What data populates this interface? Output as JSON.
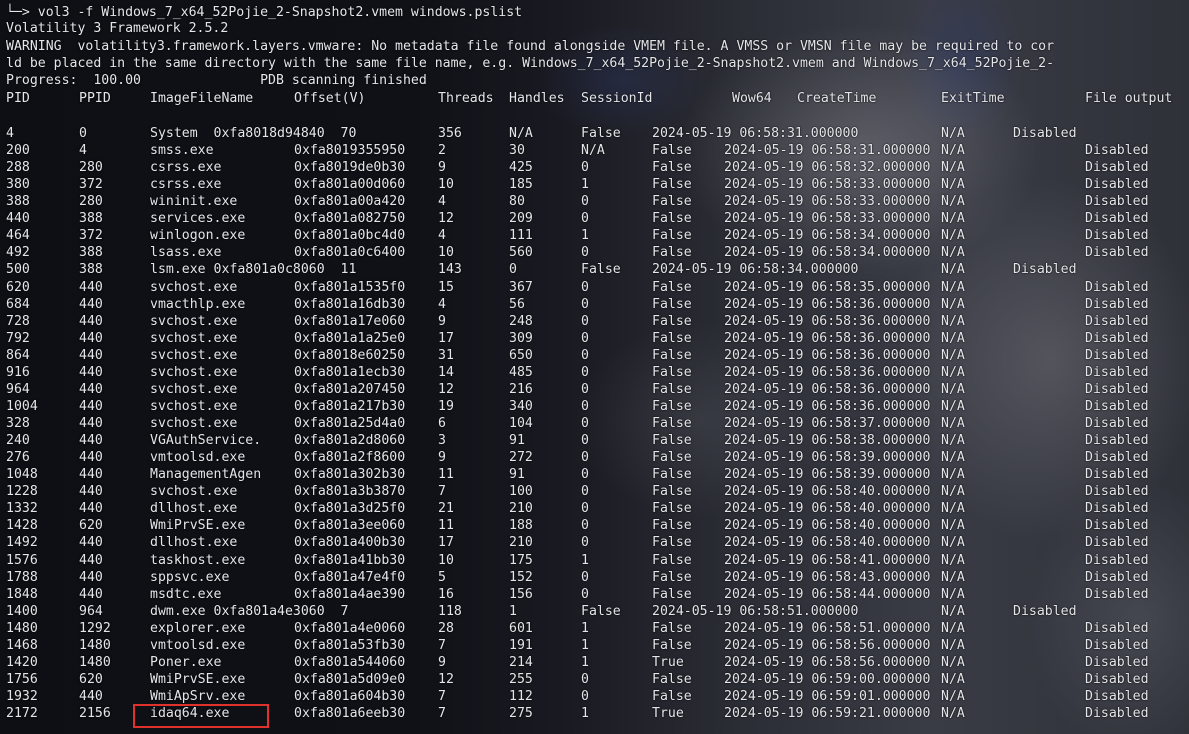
{
  "command": {
    "prompt_symbol": "└─>",
    "text": " vol3 -f Windows_7_x64_52Pojie_2-Snapshot2.vmem windows.pslist"
  },
  "output": {
    "banner": "Volatility 3 Framework 2.5.2",
    "warning_line1": "WARNING  volatility3.framework.layers.vmware: No metadata file found alongside VMEM file. A VMSS or VMSN file may be required to cor",
    "warning_line2": "ld be placed in the same directory with the same file name, e.g. Windows_7_x64_52Pojie_2-Snapshot2.vmem and Windows_7_x64_52Pojie_2-",
    "progress": "Progress:  100.00               PDB scanning finished"
  },
  "table": {
    "headers": [
      "PID",
      "PPID",
      "ImageFileName",
      "Offset(V)",
      "Threads",
      "Handles",
      "SessionId",
      "Wow64",
      "CreateTime",
      "ExitTime",
      "File output"
    ],
    "rows": [
      {
        "malformed": true,
        "pid": "4",
        "ppid": "0",
        "name": "System  0xfa8018d94840  70",
        "threads": "356",
        "handles": "N/A",
        "wow": "False",
        "ct": "2024-05-19 06:58:31.000000",
        "et": "N/A",
        "fo": "Disabled"
      },
      {
        "pid": "200",
        "ppid": "4",
        "name": "smss.exe",
        "off": "0xfa8019355950",
        "threads": "2",
        "handles": "30",
        "sess": "N/A",
        "wow": "False",
        "ct": "2024-05-19 06:58:31.000000",
        "et": "N/A",
        "fo": "Disabled"
      },
      {
        "pid": "288",
        "ppid": "280",
        "name": "csrss.exe",
        "off": "0xfa8019de0b30",
        "threads": "9",
        "handles": "425",
        "sess": "0",
        "wow": "False",
        "ct": "2024-05-19 06:58:32.000000",
        "et": "N/A",
        "fo": "Disabled"
      },
      {
        "pid": "380",
        "ppid": "372",
        "name": "csrss.exe",
        "off": "0xfa801a00d060",
        "threads": "10",
        "handles": "185",
        "sess": "1",
        "wow": "False",
        "ct": "2024-05-19 06:58:33.000000",
        "et": "N/A",
        "fo": "Disabled"
      },
      {
        "pid": "388",
        "ppid": "280",
        "name": "wininit.exe",
        "off": "0xfa801a00a420",
        "threads": "4",
        "handles": "80",
        "sess": "0",
        "wow": "False",
        "ct": "2024-05-19 06:58:33.000000",
        "et": "N/A",
        "fo": "Disabled"
      },
      {
        "pid": "440",
        "ppid": "388",
        "name": "services.exe",
        "off": "0xfa801a082750",
        "threads": "12",
        "handles": "209",
        "sess": "0",
        "wow": "False",
        "ct": "2024-05-19 06:58:33.000000",
        "et": "N/A",
        "fo": "Disabled"
      },
      {
        "pid": "464",
        "ppid": "372",
        "name": "winlogon.exe",
        "off": "0xfa801a0bc4d0",
        "threads": "4",
        "handles": "111",
        "sess": "1",
        "wow": "False",
        "ct": "2024-05-19 06:58:34.000000",
        "et": "N/A",
        "fo": "Disabled"
      },
      {
        "pid": "492",
        "ppid": "388",
        "name": "lsass.exe",
        "off": "0xfa801a0c6400",
        "threads": "10",
        "handles": "560",
        "sess": "0",
        "wow": "False",
        "ct": "2024-05-19 06:58:34.000000",
        "et": "N/A",
        "fo": "Disabled"
      },
      {
        "malformed": true,
        "pid": "500",
        "ppid": "388",
        "name": "lsm.exe 0xfa801a0c8060  11",
        "threads": "143",
        "handles": "0",
        "wow": "False",
        "ct": "2024-05-19 06:58:34.000000",
        "et": "N/A",
        "fo": "Disabled"
      },
      {
        "pid": "620",
        "ppid": "440",
        "name": "svchost.exe",
        "off": "0xfa801a1535f0",
        "threads": "15",
        "handles": "367",
        "sess": "0",
        "wow": "False",
        "ct": "2024-05-19 06:58:35.000000",
        "et": "N/A",
        "fo": "Disabled"
      },
      {
        "pid": "684",
        "ppid": "440",
        "name": "vmacthlp.exe",
        "off": "0xfa801a16db30",
        "threads": "4",
        "handles": "56",
        "sess": "0",
        "wow": "False",
        "ct": "2024-05-19 06:58:36.000000",
        "et": "N/A",
        "fo": "Disabled"
      },
      {
        "pid": "728",
        "ppid": "440",
        "name": "svchost.exe",
        "off": "0xfa801a17e060",
        "threads": "9",
        "handles": "248",
        "sess": "0",
        "wow": "False",
        "ct": "2024-05-19 06:58:36.000000",
        "et": "N/A",
        "fo": "Disabled"
      },
      {
        "pid": "792",
        "ppid": "440",
        "name": "svchost.exe",
        "off": "0xfa801a1a25e0",
        "threads": "17",
        "handles": "309",
        "sess": "0",
        "wow": "False",
        "ct": "2024-05-19 06:58:36.000000",
        "et": "N/A",
        "fo": "Disabled"
      },
      {
        "pid": "864",
        "ppid": "440",
        "name": "svchost.exe",
        "off": "0xfa8018e60250",
        "threads": "31",
        "handles": "650",
        "sess": "0",
        "wow": "False",
        "ct": "2024-05-19 06:58:36.000000",
        "et": "N/A",
        "fo": "Disabled"
      },
      {
        "pid": "916",
        "ppid": "440",
        "name": "svchost.exe",
        "off": "0xfa801a1ecb30",
        "threads": "14",
        "handles": "485",
        "sess": "0",
        "wow": "False",
        "ct": "2024-05-19 06:58:36.000000",
        "et": "N/A",
        "fo": "Disabled"
      },
      {
        "pid": "964",
        "ppid": "440",
        "name": "svchost.exe",
        "off": "0xfa801a207450",
        "threads": "12",
        "handles": "216",
        "sess": "0",
        "wow": "False",
        "ct": "2024-05-19 06:58:36.000000",
        "et": "N/A",
        "fo": "Disabled"
      },
      {
        "pid": "1004",
        "ppid": "440",
        "name": "svchost.exe",
        "off": "0xfa801a217b30",
        "threads": "19",
        "handles": "340",
        "sess": "0",
        "wow": "False",
        "ct": "2024-05-19 06:58:36.000000",
        "et": "N/A",
        "fo": "Disabled"
      },
      {
        "pid": "328",
        "ppid": "440",
        "name": "svchost.exe",
        "off": "0xfa801a25d4a0",
        "threads": "6",
        "handles": "104",
        "sess": "0",
        "wow": "False",
        "ct": "2024-05-19 06:58:37.000000",
        "et": "N/A",
        "fo": "Disabled"
      },
      {
        "pid": "240",
        "ppid": "440",
        "name": "VGAuthService.",
        "off": "0xfa801a2d8060",
        "threads": "3",
        "handles": "91",
        "sess": "0",
        "wow": "False",
        "ct": "2024-05-19 06:58:38.000000",
        "et": "N/A",
        "fo": "Disabled"
      },
      {
        "pid": "276",
        "ppid": "440",
        "name": "vmtoolsd.exe",
        "off": "0xfa801a2f8600",
        "threads": "9",
        "handles": "272",
        "sess": "0",
        "wow": "False",
        "ct": "2024-05-19 06:58:39.000000",
        "et": "N/A",
        "fo": "Disabled"
      },
      {
        "pid": "1048",
        "ppid": "440",
        "name": "ManagementAgen",
        "off": "0xfa801a302b30",
        "threads": "11",
        "handles": "91",
        "sess": "0",
        "wow": "False",
        "ct": "2024-05-19 06:58:39.000000",
        "et": "N/A",
        "fo": "Disabled"
      },
      {
        "pid": "1228",
        "ppid": "440",
        "name": "svchost.exe",
        "off": "0xfa801a3b3870",
        "threads": "7",
        "handles": "100",
        "sess": "0",
        "wow": "False",
        "ct": "2024-05-19 06:58:40.000000",
        "et": "N/A",
        "fo": "Disabled"
      },
      {
        "pid": "1332",
        "ppid": "440",
        "name": "dllhost.exe",
        "off": "0xfa801a3d25f0",
        "threads": "21",
        "handles": "210",
        "sess": "0",
        "wow": "False",
        "ct": "2024-05-19 06:58:40.000000",
        "et": "N/A",
        "fo": "Disabled"
      },
      {
        "pid": "1428",
        "ppid": "620",
        "name": "WmiPrvSE.exe",
        "off": "0xfa801a3ee060",
        "threads": "11",
        "handles": "188",
        "sess": "0",
        "wow": "False",
        "ct": "2024-05-19 06:58:40.000000",
        "et": "N/A",
        "fo": "Disabled"
      },
      {
        "pid": "1492",
        "ppid": "440",
        "name": "dllhost.exe",
        "off": "0xfa801a400b30",
        "threads": "17",
        "handles": "210",
        "sess": "0",
        "wow": "False",
        "ct": "2024-05-19 06:58:40.000000",
        "et": "N/A",
        "fo": "Disabled"
      },
      {
        "pid": "1576",
        "ppid": "440",
        "name": "taskhost.exe",
        "off": "0xfa801a41bb30",
        "threads": "10",
        "handles": "175",
        "sess": "1",
        "wow": "False",
        "ct": "2024-05-19 06:58:41.000000",
        "et": "N/A",
        "fo": "Disabled"
      },
      {
        "pid": "1788",
        "ppid": "440",
        "name": "sppsvc.exe",
        "off": "0xfa801a47e4f0",
        "threads": "5",
        "handles": "152",
        "sess": "0",
        "wow": "False",
        "ct": "2024-05-19 06:58:43.000000",
        "et": "N/A",
        "fo": "Disabled"
      },
      {
        "pid": "1848",
        "ppid": "440",
        "name": "msdtc.exe",
        "off": "0xfa801a4ae390",
        "threads": "16",
        "handles": "156",
        "sess": "0",
        "wow": "False",
        "ct": "2024-05-19 06:58:44.000000",
        "et": "N/A",
        "fo": "Disabled"
      },
      {
        "malformed": true,
        "pid": "1400",
        "ppid": "964",
        "name": "dwm.exe 0xfa801a4e3060  7",
        "threads": "118",
        "handles": "1",
        "wow": "False",
        "ct": "2024-05-19 06:58:51.000000",
        "et": "N/A",
        "fo": "Disabled"
      },
      {
        "pid": "1480",
        "ppid": "1292",
        "name": "explorer.exe",
        "off": "0xfa801a4e0060",
        "threads": "28",
        "handles": "601",
        "sess": "1",
        "wow": "False",
        "ct": "2024-05-19 06:58:51.000000",
        "et": "N/A",
        "fo": "Disabled"
      },
      {
        "pid": "1468",
        "ppid": "1480",
        "name": "vmtoolsd.exe",
        "off": "0xfa801a53fb30",
        "threads": "7",
        "handles": "191",
        "sess": "1",
        "wow": "False",
        "ct": "2024-05-19 06:58:56.000000",
        "et": "N/A",
        "fo": "Disabled"
      },
      {
        "pid": "1420",
        "ppid": "1480",
        "name": "Poner.exe",
        "off": "0xfa801a544060",
        "threads": "9",
        "handles": "214",
        "sess": "1",
        "wow": "True",
        "ct": "2024-05-19 06:58:56.000000",
        "et": "N/A",
        "fo": "Disabled"
      },
      {
        "pid": "1756",
        "ppid": "620",
        "name": "WmiPrvSE.exe",
        "off": "0xfa801a5d09e0",
        "threads": "12",
        "handles": "255",
        "sess": "0",
        "wow": "False",
        "ct": "2024-05-19 06:59:00.000000",
        "et": "N/A",
        "fo": "Disabled"
      },
      {
        "pid": "1932",
        "ppid": "440",
        "name": "WmiApSrv.exe",
        "off": "0xfa801a604b30",
        "threads": "7",
        "handles": "112",
        "sess": "0",
        "wow": "False",
        "ct": "2024-05-19 06:59:01.000000",
        "et": "N/A",
        "fo": "Disabled"
      },
      {
        "pid": "2172",
        "ppid": "2156",
        "name": "idaq64.exe",
        "off": "0xfa801a6eeb30",
        "threads": "7",
        "handles": "275",
        "sess": "1",
        "wow": "True",
        "ct": "2024-05-19 06:59:21.000000",
        "et": "N/A",
        "fo": "Disabled"
      }
    ]
  },
  "colors": {
    "highlight": "#e0322d",
    "text": "#e4e6ea"
  }
}
